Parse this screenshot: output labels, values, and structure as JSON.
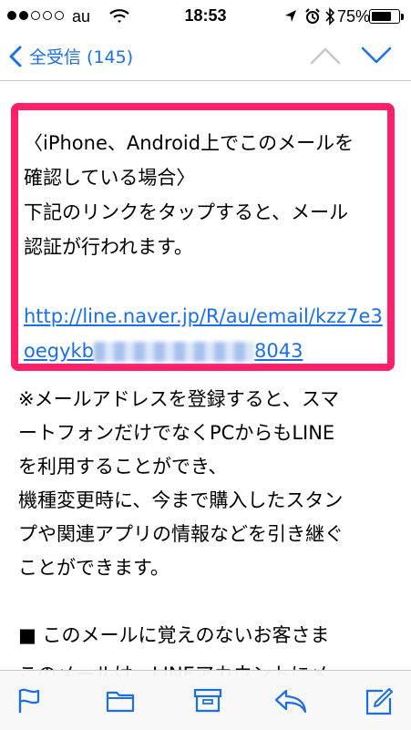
{
  "status_bar": {
    "carrier": "au",
    "time": "18:53",
    "battery": "75%",
    "battery_level": 0.75
  },
  "nav": {
    "back_label": "全受信 (145)",
    "icons": [
      "chevron-left-icon",
      "chevron-up-icon",
      "chevron-down-icon"
    ]
  },
  "message": {
    "highlight_lines": [
      "〈iPhone、Android上でこのメールを",
      "確認している場合〉",
      "下記のリンクをタップすると、メール",
      "認証が行われます。"
    ],
    "link_line1": "http://line.naver.jp/R/au/email/kzz7e3",
    "link_line2_start": "oegykb",
    "link_line2_end": "8043",
    "body_lines": [
      "※メールアドレスを登録すると、スマ",
      "ートフォンだけでなくPCからもLINE",
      "を利用することができ、",
      "機種変更時に、今まで購入したスタン",
      "プや関連アプリの情報などを引き継ぐ",
      "ことができます。",
      "",
      "■ このメールに覚えのないお客さま"
    ],
    "cut_line": "このメールは、LINEアカウントにメ"
  },
  "colors": {
    "accent": "#1b6fe6",
    "highlight_border": "#ff1f6a"
  },
  "toolbar": {
    "icons": [
      "flag-icon",
      "folder-icon",
      "archive-icon",
      "reply-icon",
      "compose-icon"
    ]
  }
}
